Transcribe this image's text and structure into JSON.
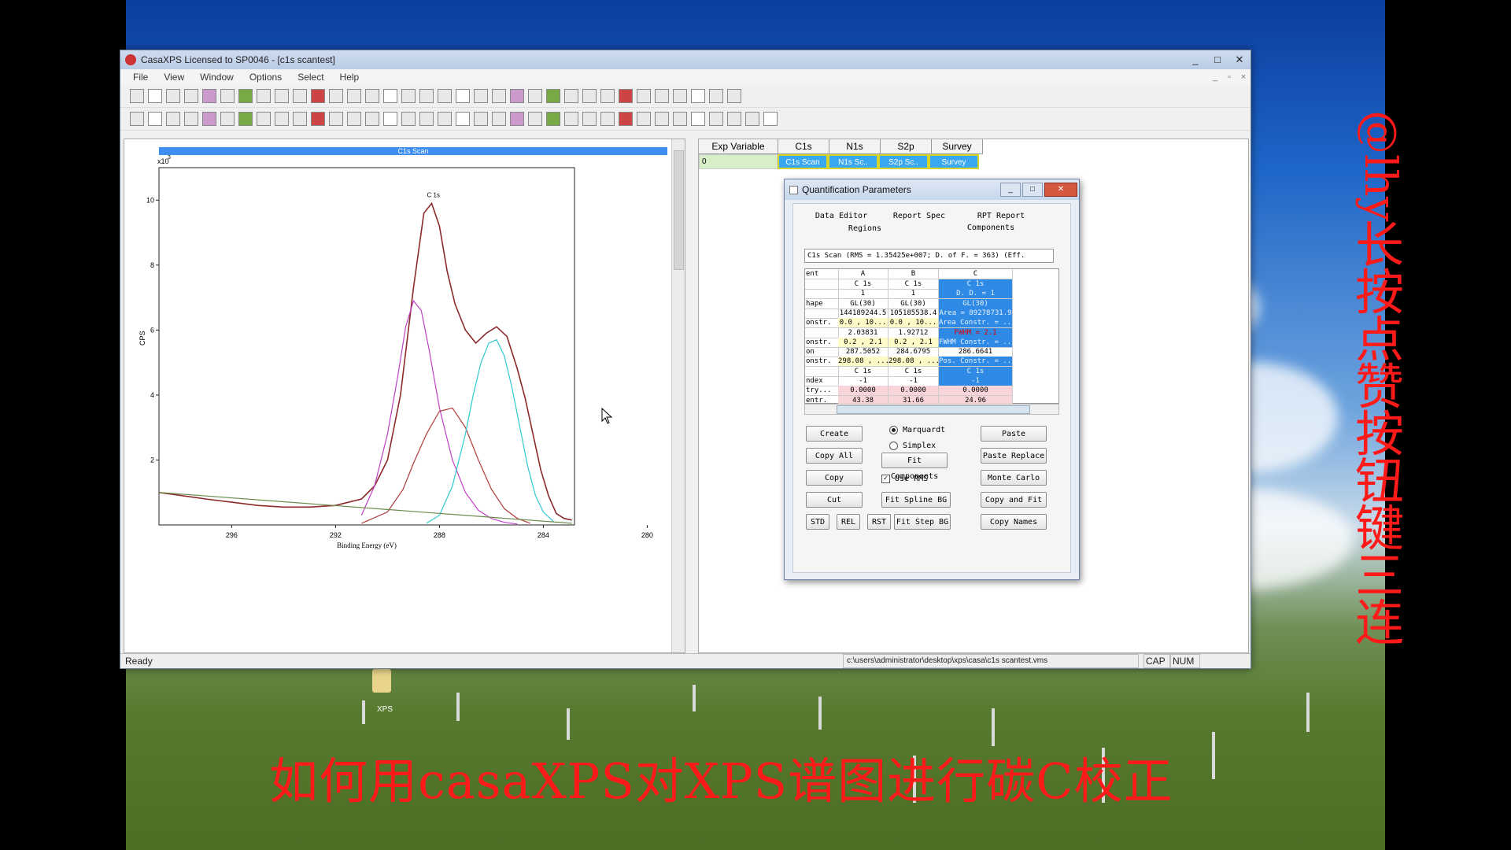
{
  "window": {
    "title": "CasaXPS Licensed to SP0046 - [c1s scantest]",
    "controls": [
      "_",
      "□",
      "✕"
    ]
  },
  "menu": [
    "File",
    "View",
    "Window",
    "Options",
    "Select",
    "Help"
  ],
  "plot": {
    "header": "C1s Scan",
    "y_exponent": "x10",
    "y_exponent_power": "3",
    "ylabel": "CPS",
    "xlabel": "Binding Energy (eV)",
    "peak_label": "C 1s"
  },
  "chart_data": {
    "type": "line",
    "xlabel": "Binding Energy (eV)",
    "ylabel": "CPS",
    "x_reversed": true,
    "xlim": [
      282.8,
      298.8
    ],
    "ylim": [
      0,
      11
    ],
    "x_ticks": [
      296,
      292,
      288,
      284,
      280
    ],
    "y_ticks": [
      2,
      4,
      6,
      8,
      10
    ],
    "series": [
      {
        "name": "envelope",
        "color": "#8b2a2a",
        "x": [
          298.8,
          297,
          296,
          295,
          294,
          293,
          292,
          291,
          290.5,
          290,
          289.5,
          289,
          288.6,
          288.3,
          288,
          287.7,
          287.4,
          287,
          286.6,
          286.2,
          285.8,
          285.4,
          285,
          284.7,
          284.4,
          284.1,
          283.8,
          283.5,
          283.2,
          282.9
        ],
        "y": [
          1.0,
          0.8,
          0.7,
          0.6,
          0.55,
          0.55,
          0.6,
          0.8,
          1.2,
          2.0,
          4.0,
          7.3,
          9.6,
          9.9,
          9.2,
          7.8,
          6.8,
          6.0,
          5.6,
          5.9,
          6.1,
          5.8,
          4.8,
          3.9,
          2.8,
          1.7,
          0.9,
          0.35,
          0.2,
          0.15
        ]
      },
      {
        "name": "comp-A",
        "color": "#c040c8",
        "x": [
          291,
          290.5,
          290,
          289.6,
          289.3,
          289,
          288.7,
          288.4,
          288,
          287.5,
          287,
          286.5,
          286,
          285.5,
          285
        ],
        "y": [
          0.3,
          1.2,
          2.8,
          4.6,
          6.1,
          6.9,
          6.6,
          5.4,
          3.6,
          2.0,
          1.0,
          0.45,
          0.2,
          0.08,
          0.03
        ]
      },
      {
        "name": "comp-B",
        "color": "#b03a3a",
        "x": [
          291,
          290,
          289.4,
          289,
          288.5,
          288,
          287.5,
          287,
          286.5,
          286,
          285.5,
          285,
          284.5
        ],
        "y": [
          0.05,
          0.4,
          1.1,
          1.9,
          2.8,
          3.5,
          3.6,
          3.0,
          2.0,
          1.1,
          0.5,
          0.2,
          0.05
        ]
      },
      {
        "name": "comp-C",
        "color": "#30c8d0",
        "x": [
          288.5,
          288,
          287.5,
          287,
          286.7,
          286.4,
          286.1,
          285.8,
          285.5,
          285.2,
          284.9,
          284.6,
          284.3,
          284,
          283.6
        ],
        "y": [
          0.05,
          0.3,
          1.2,
          2.8,
          4.0,
          5.0,
          5.6,
          5.7,
          5.2,
          4.2,
          3.0,
          1.8,
          0.9,
          0.4,
          0.1
        ]
      },
      {
        "name": "background",
        "color": "#6a8a4a",
        "x": [
          298.8,
          282.9
        ],
        "y": [
          1.0,
          0.05
        ]
      }
    ]
  },
  "table": {
    "headers": [
      "Exp Variable",
      "C1s",
      "N1s",
      "S2p",
      "Survey"
    ],
    "row": [
      "0",
      "C1s Scan",
      "N1s Sc..",
      "S2p Sc..",
      "Survey"
    ]
  },
  "dialog": {
    "title": "Quantification Parameters",
    "tabs": [
      "Data Editor",
      "Report Spec",
      "RPT Report",
      "Regions",
      "Components"
    ],
    "summary": "C1s Scan (RMS = 1.35425e+007; D. of F. = 363) (Eff.",
    "grid_headers": [
      "ent",
      "A",
      "B",
      "C"
    ],
    "grid_rows": [
      [
        "",
        "C 1s",
        "C 1s",
        "C 1s"
      ],
      [
        "",
        "1",
        "1",
        "D. D. = 1"
      ],
      [
        "hape",
        "GL(30)",
        "GL(30)",
        "GL(30)"
      ],
      [
        "",
        "144189244.5",
        "105185538.4",
        "Area = 89278731.9"
      ],
      [
        "onstr.",
        "0.0 , 10...",
        "0.0 , 10...",
        "Area Constr. = ..."
      ],
      [
        "",
        "2.03831",
        "1.92712",
        "FWHM = 2.1"
      ],
      [
        "onstr.",
        "0.2 , 2.1",
        "0.2 , 2.1",
        "FWHM Constr. = ..."
      ],
      [
        "on",
        "287.5052",
        "284.6795",
        "286.6641"
      ],
      [
        "onstr.",
        "298.08 , ...",
        "298.08 , ...",
        "Pos. Constr. = ..."
      ],
      [
        "",
        "C 1s",
        "C 1s",
        "C 1s"
      ],
      [
        "ndex",
        "-1",
        "-1",
        "-1"
      ],
      [
        "try...",
        "0.0000",
        "0.0000",
        "0.0000"
      ],
      [
        "entr.",
        "43.38",
        "31.66",
        "24.96"
      ]
    ],
    "buttons": {
      "create": "Create",
      "copy_all": "Copy All",
      "copy": "Copy",
      "cut": "Cut",
      "std": "STD",
      "rel": "REL",
      "rst": "RST",
      "fit_components": "Fit Components",
      "fit_spline_bg": "Fit Spline BG",
      "fit_step_bg": "Fit Step BG",
      "paste": "Paste",
      "paste_replace": "Paste Replace",
      "monte_carlo": "Monte Carlo",
      "copy_and_fit": "Copy and Fit",
      "copy_names": "Copy Names"
    },
    "options": {
      "marquardt": "Marquardt",
      "simplex": "Simplex",
      "use_rms": "Use RMS"
    }
  },
  "status": {
    "ready": "Ready",
    "path": "c:\\users\\administrator\\desktop\\xps\\casa\\c1s scantest.vms",
    "cap": "CAP",
    "num": "NUM"
  },
  "desktop": {
    "icon_label": "XPS"
  },
  "overlay": {
    "caption": "如何用casaXPS对XPS谱图进行碳C校正",
    "handle": "@lhy",
    "side_text": [
      "长",
      "按",
      "点",
      "赞",
      "按",
      "钮",
      "键",
      "三",
      "连"
    ]
  },
  "colors": {
    "accent_blue": "#3aa8f0",
    "overlay_red": "#ff1a1a"
  }
}
